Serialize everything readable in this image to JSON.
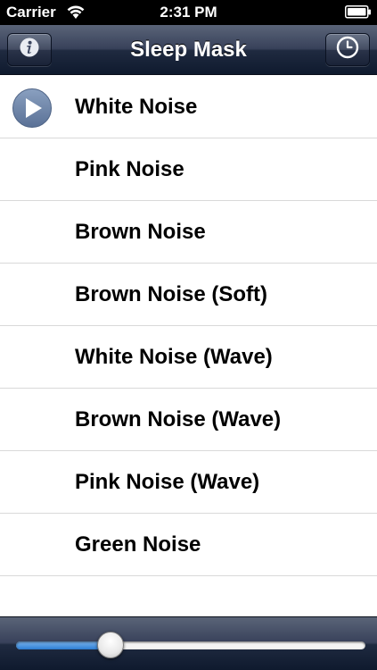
{
  "status_bar": {
    "carrier": "Carrier",
    "time": "2:31 PM",
    "wifi_icon": "wifi-icon",
    "battery_icon": "battery-icon"
  },
  "nav": {
    "title": "Sleep Mask",
    "left_icon": "info-icon",
    "right_icon": "clock-icon"
  },
  "list": {
    "items": [
      {
        "label": "White Noise",
        "playing": true
      },
      {
        "label": "Pink Noise",
        "playing": false
      },
      {
        "label": "Brown Noise",
        "playing": false
      },
      {
        "label": "Brown Noise (Soft)",
        "playing": false
      },
      {
        "label": "White Noise (Wave)",
        "playing": false
      },
      {
        "label": "Brown Noise (Wave)",
        "playing": false
      },
      {
        "label": "Pink Noise (Wave)",
        "playing": false
      },
      {
        "label": "Green Noise",
        "playing": false
      }
    ]
  },
  "volume": {
    "level": 0.27
  },
  "colors": {
    "accent": "#2e7fd6",
    "play_button": "#6b84a8"
  }
}
